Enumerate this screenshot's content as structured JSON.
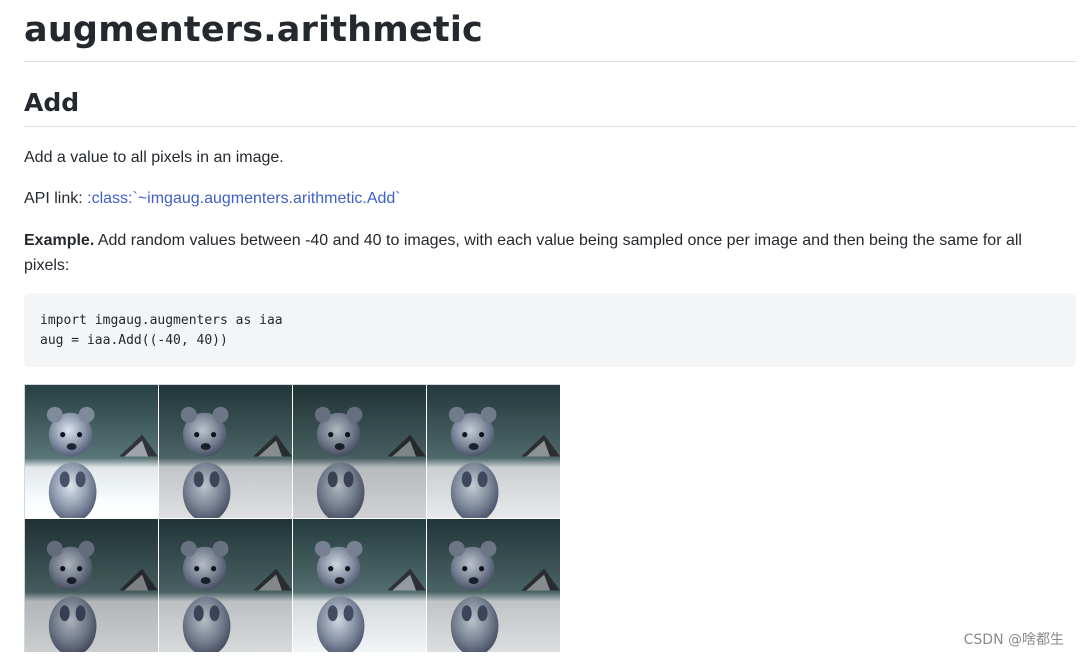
{
  "page": {
    "title": "augmenters.arithmetic",
    "section_title": "Add",
    "description": "Add a value to all pixels in an image.",
    "api_prefix": "API link: ",
    "api_link_text": ":class:`~imgaug.augmenters.arithmetic.Add`",
    "example_label": "Example.",
    "example_text": " Add random values between -40 and 40 to images, with each value being sampled once per image and then being the same for all pixels:",
    "code": "import imgaug.augmenters as iaa\naug = iaa.Add((-40, 40))"
  },
  "image_grid": {
    "subject": "quokka",
    "tiles": [
      {
        "brightness": 1.12
      },
      {
        "brightness": 0.96
      },
      {
        "brightness": 0.9
      },
      {
        "brightness": 1.0
      },
      {
        "brightness": 0.88
      },
      {
        "brightness": 0.93
      },
      {
        "brightness": 1.05
      },
      {
        "brightness": 0.95
      }
    ]
  },
  "watermark": "CSDN @啥都生"
}
